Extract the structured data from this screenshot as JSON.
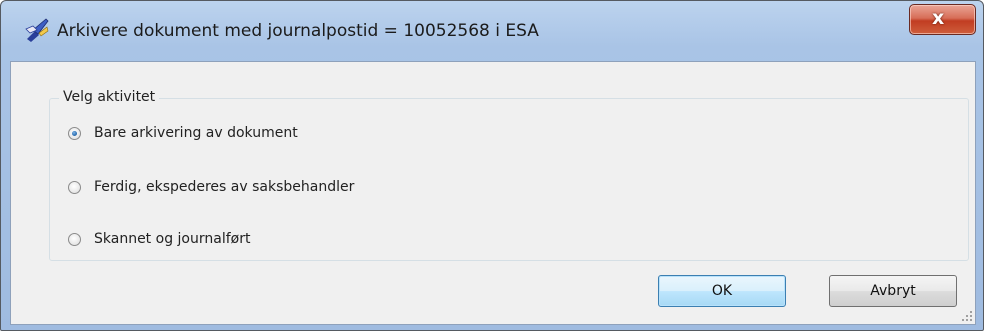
{
  "window": {
    "title": "Arkivere dokument med journalpostid = 10052568 i ESA",
    "close_glyph": "x",
    "app_icon": "quill-pen-icon"
  },
  "group": {
    "legend": "Velg aktivitet",
    "options": [
      {
        "label": "Bare arkivering av dokument",
        "checked": true
      },
      {
        "label": "Ferdig, ekspederes av saksbehandler",
        "checked": false
      },
      {
        "label": "Skannet og journalført",
        "checked": false
      }
    ]
  },
  "buttons": {
    "ok": "OK",
    "cancel": "Avbryt"
  },
  "colors": {
    "frame": "#a9c4e6",
    "client": "#f0f0f0",
    "close_button": "#c94a2c",
    "radio_accent": "#2b6fb3"
  }
}
